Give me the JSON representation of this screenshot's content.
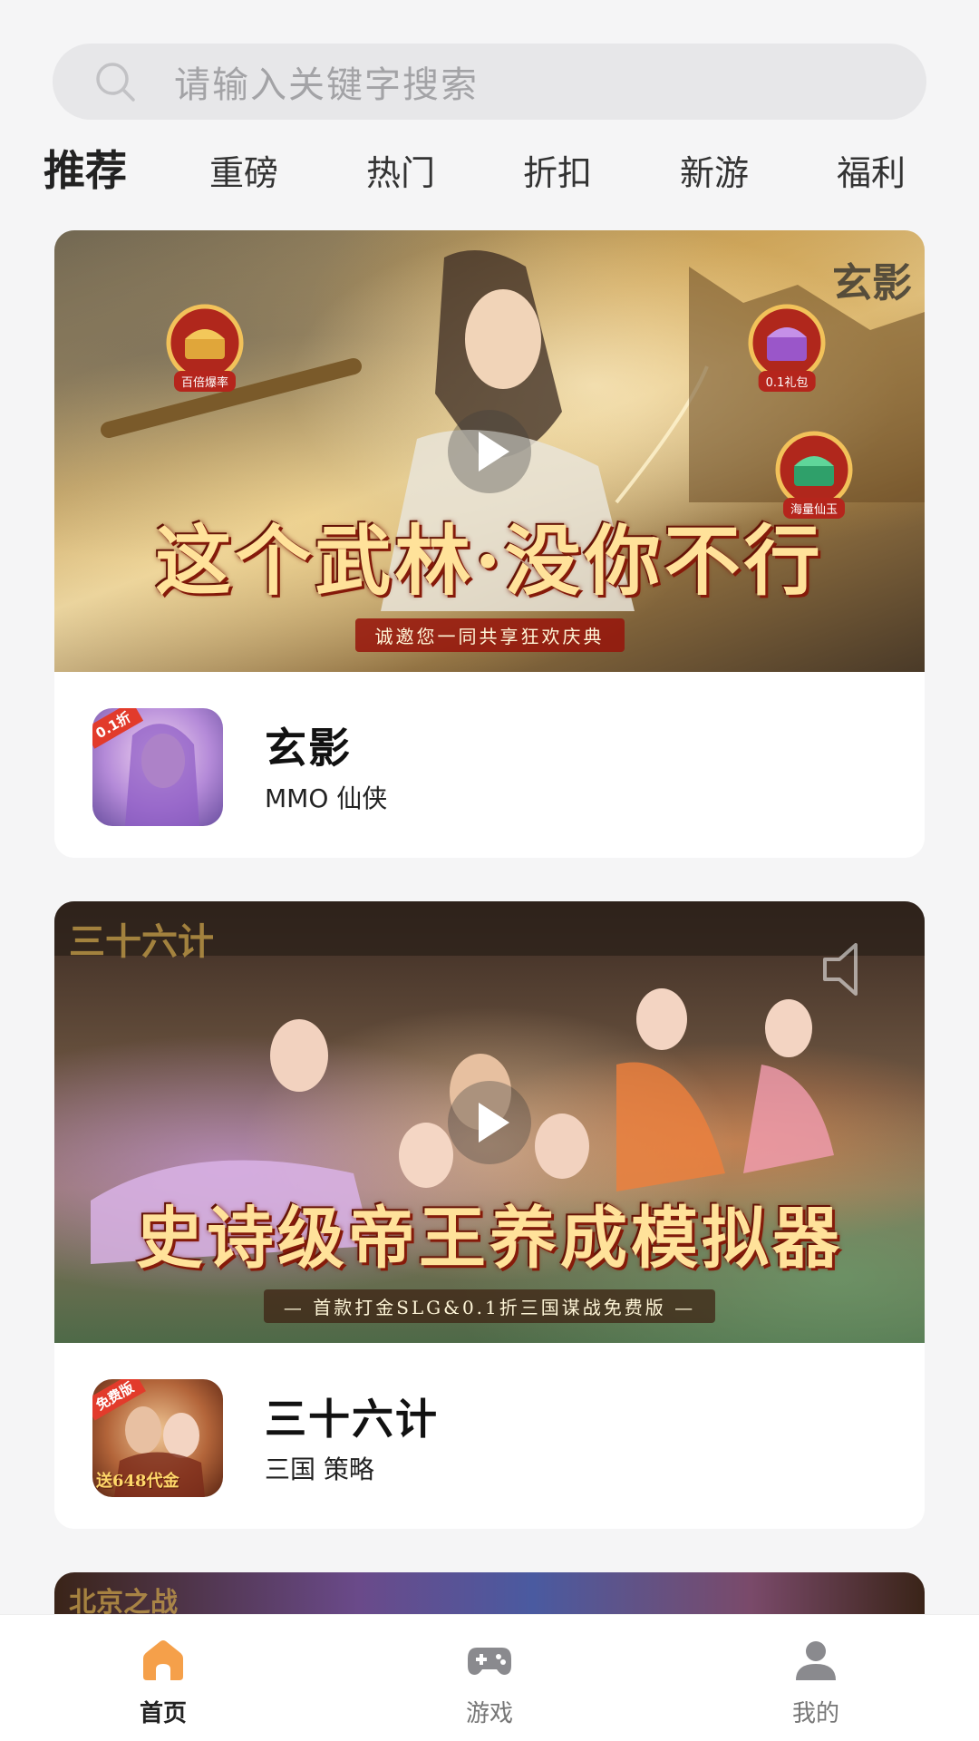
{
  "search": {
    "placeholder": "请输入关键字搜索"
  },
  "tabs": [
    {
      "label": "推荐",
      "active": true
    },
    {
      "label": "重磅"
    },
    {
      "label": "热门"
    },
    {
      "label": "折扣"
    },
    {
      "label": "新游"
    },
    {
      "label": "福利"
    }
  ],
  "cards": [
    {
      "banner_title": "这个武林·没你不行",
      "banner_subtitle": "诚邀您一同共享狂欢庆典",
      "banner_logo": "玄影",
      "banner_badges": [
        "百倍爆率",
        "0.1礼包",
        "海量仙玉"
      ],
      "icon_tag": "0.1折",
      "name": "玄影",
      "tags": "MMO 仙侠"
    },
    {
      "banner_title": "史诗级帝王养成模拟器",
      "banner_subtitle": "— 首款打金SLG&0.1折三国谋战免费版 —",
      "banner_logo": "三十六计",
      "icon_tag": "免费版",
      "icon_caption": "送648代金",
      "name": "三十六计",
      "tags": "三国 策略"
    },
    {
      "banner_logo": "北京之战"
    }
  ],
  "bottom_nav": [
    {
      "label": "首页",
      "icon": "home-icon",
      "active": true
    },
    {
      "label": "游戏",
      "icon": "gamepad-icon"
    },
    {
      "label": "我的",
      "icon": "user-icon"
    }
  ],
  "colors": {
    "accent": "#f5a04a",
    "background": "#f5f5f6",
    "card": "#ffffff"
  }
}
